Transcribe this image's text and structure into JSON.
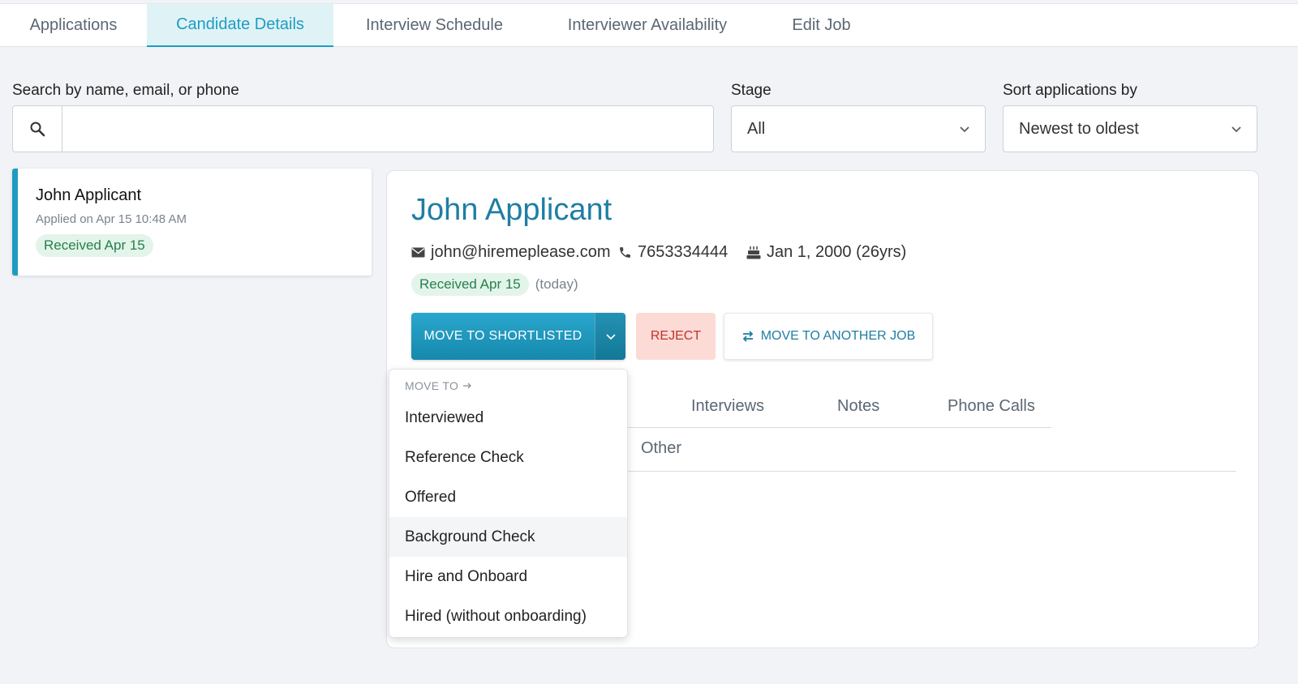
{
  "nav": {
    "tabs": [
      {
        "label": "Applications"
      },
      {
        "label": "Candidate Details"
      },
      {
        "label": "Interview Schedule"
      },
      {
        "label": "Interviewer Availability"
      },
      {
        "label": "Edit Job"
      }
    ],
    "active": "Candidate Details"
  },
  "filters": {
    "search_label": "Search by name, email, or phone",
    "search_value": "",
    "stage_label": "Stage",
    "stage_value": "All",
    "sort_label": "Sort applications by",
    "sort_value": "Newest to oldest"
  },
  "application_list": [
    {
      "name": "John Applicant",
      "applied": "Applied on Apr 15 10:48 AM",
      "status": "Received Apr 15"
    }
  ],
  "candidate": {
    "name": "John Applicant",
    "email": "john@hiremeplease.com",
    "phone": "7653334444",
    "birthday": "Jan 1, 2000 (26yrs)",
    "status": "Received Apr 15",
    "status_note": "(today)"
  },
  "actions": {
    "primary": "MOVE TO SHORTLISTED",
    "reject": "REJECT",
    "move_job": "MOVE TO ANOTHER JOB"
  },
  "detail_tabs": [
    "Interviews",
    "Notes",
    "Phone Calls"
  ],
  "sub_tabs": [
    "Other"
  ],
  "move_menu": {
    "header": "MOVE TO",
    "items": [
      "Interviewed",
      "Reference Check",
      "Offered",
      "Background Check",
      "Hire and Onboard",
      "Hired (without onboarding)"
    ],
    "hovered": "Background Check"
  },
  "colors": {
    "accent": "#1e9cc0",
    "name": "#1f7ea3",
    "success_bg": "#e3f4ea",
    "success_text": "#25804c",
    "reject_bg": "#fcdad5",
    "reject_text": "#c0342b"
  }
}
